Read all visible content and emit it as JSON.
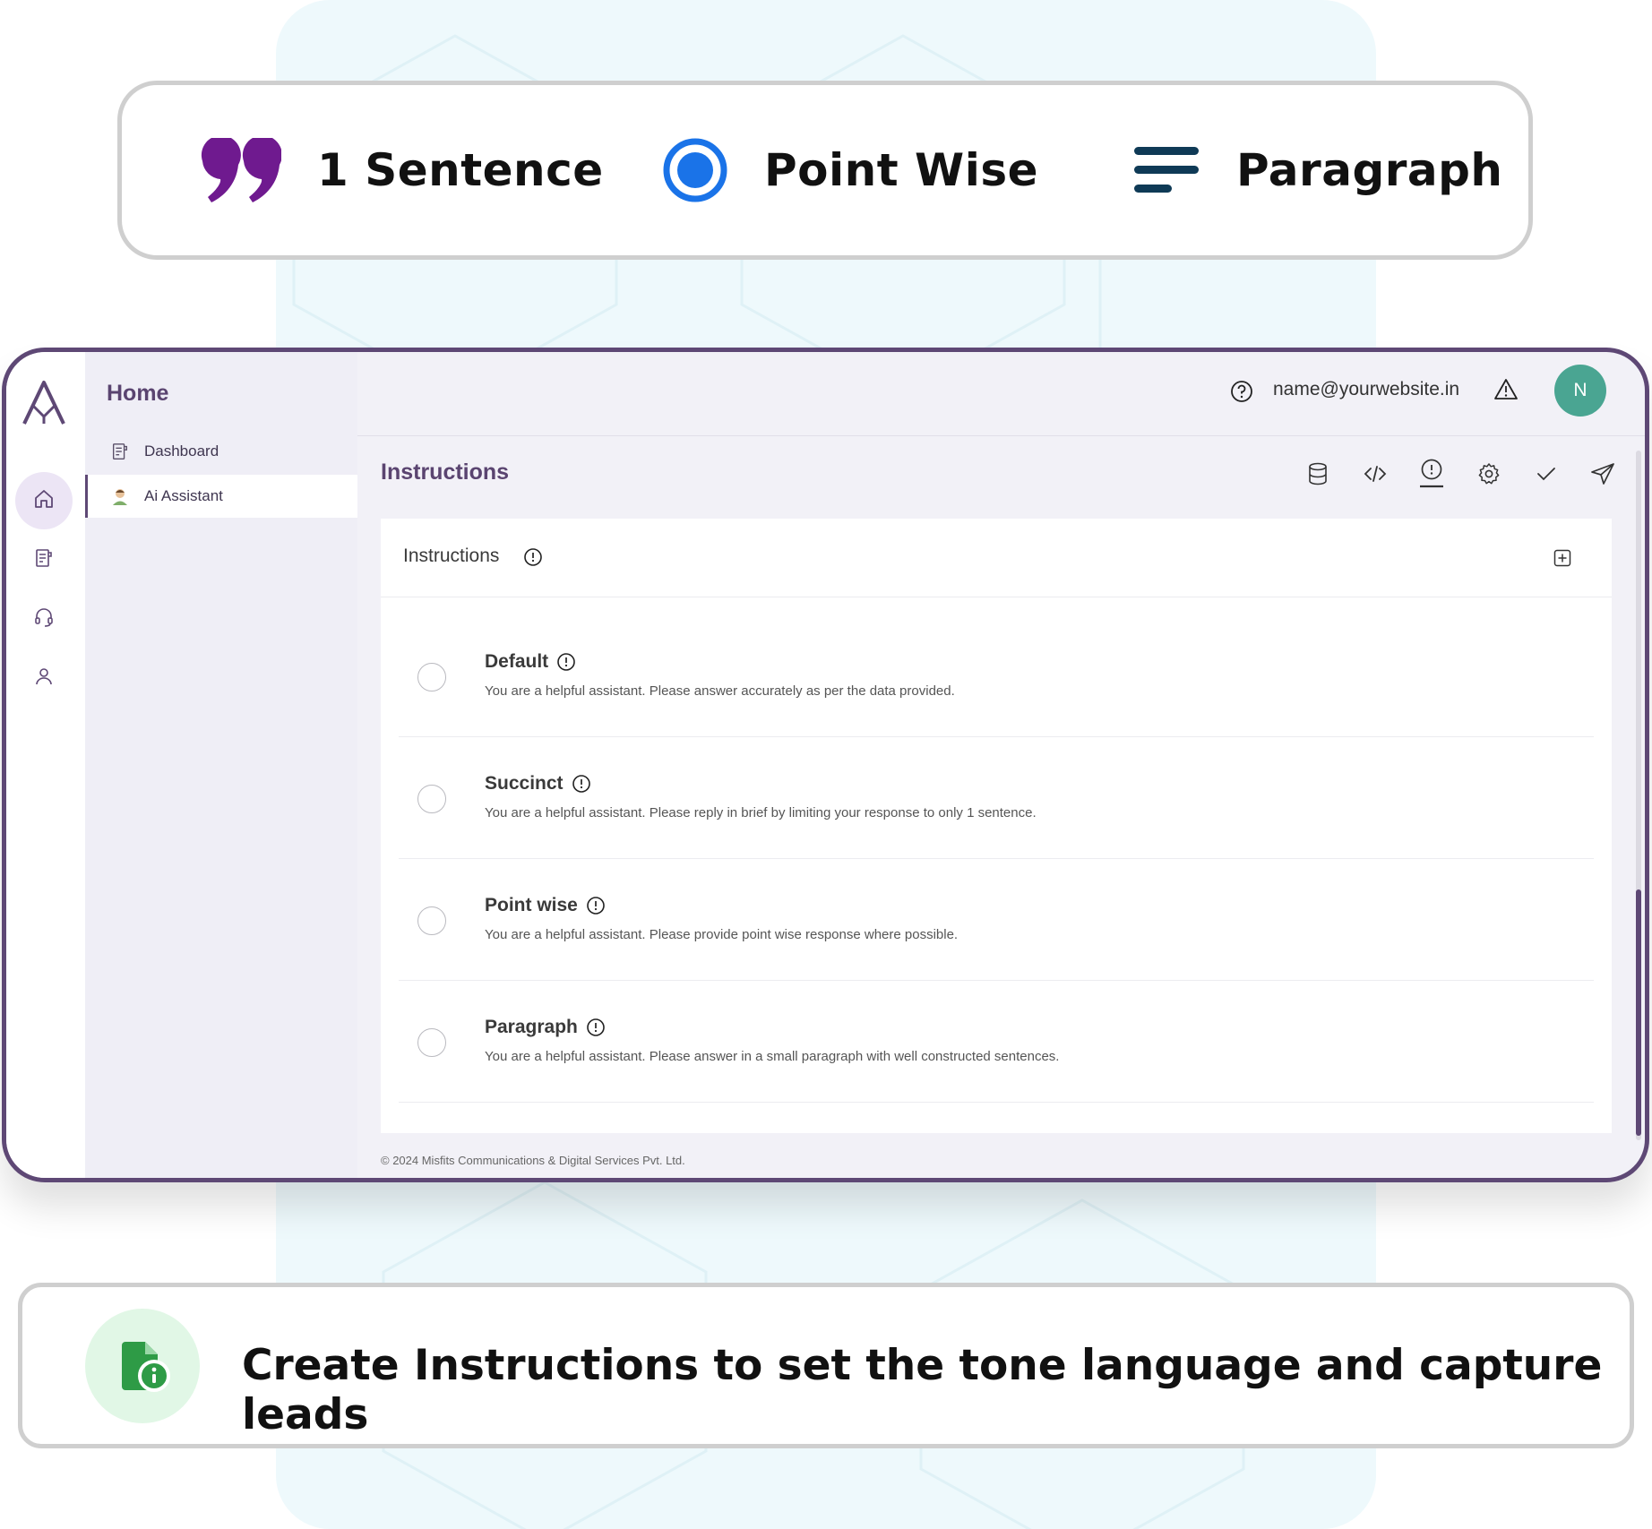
{
  "format_options": [
    {
      "label": "1 Sentence",
      "icon": "quote-icon"
    },
    {
      "label": "Point Wise",
      "icon": "radio-dot-icon"
    },
    {
      "label": "Paragraph",
      "icon": "text-lines-icon"
    }
  ],
  "sidebar": {
    "section_title": "Home",
    "items": [
      {
        "label": "Dashboard",
        "icon": "dashboard-icon"
      },
      {
        "label": "Ai Assistant",
        "icon": "assistant-avatar-icon",
        "active": true
      }
    ]
  },
  "rail_icons": [
    "home-icon",
    "document-icon",
    "headset-icon",
    "user-icon"
  ],
  "header": {
    "email": "name@yourwebsite.in",
    "avatar_initial": "N"
  },
  "page": {
    "title": "Instructions",
    "toolbar_icons": [
      "database-icon",
      "code-icon",
      "alert-icon",
      "settings-icon",
      "check-icon",
      "send-icon"
    ]
  },
  "card": {
    "title": "Instructions",
    "options": [
      {
        "name": "Default",
        "description": "You are a helpful assistant. Please answer accurately as per the data provided."
      },
      {
        "name": "Succinct",
        "description": "You are a helpful assistant. Please reply in brief by limiting your response to only 1 sentence."
      },
      {
        "name": "Point wise",
        "description": "You are a helpful assistant. Please provide point wise response where possible."
      },
      {
        "name": "Paragraph",
        "description": "You are a helpful assistant. Please answer in a small paragraph with well constructed sentences."
      }
    ]
  },
  "footer": "© 2024 Misfits Communications & Digital Services Pvt. Ltd.",
  "banner": {
    "message": "Create Instructions to set the tone language and capture leads",
    "icon": "document-info-icon"
  },
  "colors": {
    "brand_purple": "#5e4875",
    "quote_purple": "#6f1a8f",
    "point_blue": "#1a73e8",
    "paragraph_teal": "#0f3a56",
    "avatar_teal": "#4aa592",
    "banner_green": "#2e9b46"
  }
}
